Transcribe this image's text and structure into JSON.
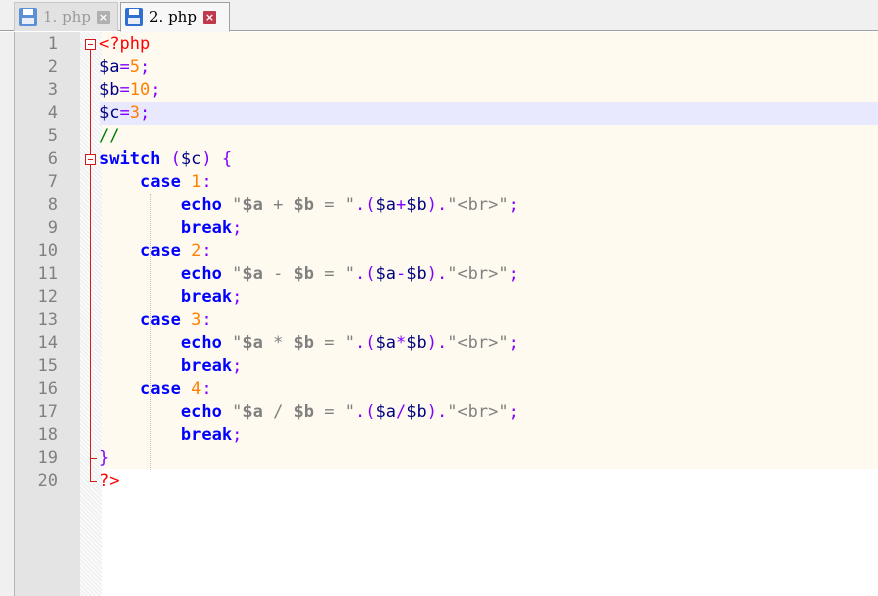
{
  "tabs": [
    {
      "label": "1. php",
      "active": false,
      "close_glyph": "×",
      "icon": "save-disk-icon",
      "icon_color": "#5b8fd6",
      "close_color": "#b0b0b0"
    },
    {
      "label": "2. php",
      "active": true,
      "close_glyph": "×",
      "icon": "save-disk-icon",
      "icon_color": "#2f6fd0",
      "close_color": "#c0384b"
    }
  ],
  "editor": {
    "current_line": 4,
    "line_numbers": [
      "1",
      "2",
      "3",
      "4",
      "5",
      "6",
      "7",
      "8",
      "9",
      "10",
      "11",
      "12",
      "13",
      "14",
      "15",
      "16",
      "17",
      "18",
      "19",
      "20"
    ],
    "lines": [
      [
        {
          "t": "<?php",
          "c": "php"
        }
      ],
      [
        {
          "t": "$a",
          "c": "var"
        },
        {
          "t": "=",
          "c": "op"
        },
        {
          "t": "5",
          "c": "num"
        },
        {
          "t": ";",
          "c": "op"
        }
      ],
      [
        {
          "t": "$b",
          "c": "var"
        },
        {
          "t": "=",
          "c": "op"
        },
        {
          "t": "10",
          "c": "num"
        },
        {
          "t": ";",
          "c": "op"
        }
      ],
      [
        {
          "t": "$c",
          "c": "var"
        },
        {
          "t": "=",
          "c": "op"
        },
        {
          "t": "3",
          "c": "num"
        },
        {
          "t": ";",
          "c": "op"
        }
      ],
      [
        {
          "t": "//",
          "c": "cm"
        }
      ],
      [
        {
          "t": "switch",
          "c": "kw"
        },
        {
          "t": " ",
          "c": ""
        },
        {
          "t": "(",
          "c": "op"
        },
        {
          "t": "$c",
          "c": "var"
        },
        {
          "t": ")",
          "c": "op"
        },
        {
          "t": " ",
          "c": ""
        },
        {
          "t": "{",
          "c": "op"
        }
      ],
      [
        {
          "t": "    ",
          "c": ""
        },
        {
          "t": "case",
          "c": "kw"
        },
        {
          "t": " ",
          "c": ""
        },
        {
          "t": "1",
          "c": "num"
        },
        {
          "t": ":",
          "c": "op"
        }
      ],
      [
        {
          "t": "        ",
          "c": ""
        },
        {
          "t": "echo",
          "c": "kw"
        },
        {
          "t": " ",
          "c": ""
        },
        {
          "t": "\"",
          "c": "str"
        },
        {
          "t": "$a",
          "c": "sv"
        },
        {
          "t": " + ",
          "c": "str"
        },
        {
          "t": "$b",
          "c": "sv"
        },
        {
          "t": " = \"",
          "c": "str"
        },
        {
          "t": ".",
          "c": "op"
        },
        {
          "t": "(",
          "c": "op"
        },
        {
          "t": "$a",
          "c": "var"
        },
        {
          "t": "+",
          "c": "op"
        },
        {
          "t": "$b",
          "c": "var"
        },
        {
          "t": ")",
          "c": "op"
        },
        {
          "t": ".",
          "c": "op"
        },
        {
          "t": "\"<br>\"",
          "c": "str"
        },
        {
          "t": ";",
          "c": "op"
        }
      ],
      [
        {
          "t": "        ",
          "c": ""
        },
        {
          "t": "break",
          "c": "kw"
        },
        {
          "t": ";",
          "c": "op"
        }
      ],
      [
        {
          "t": "    ",
          "c": ""
        },
        {
          "t": "case",
          "c": "kw"
        },
        {
          "t": " ",
          "c": ""
        },
        {
          "t": "2",
          "c": "num"
        },
        {
          "t": ":",
          "c": "op"
        }
      ],
      [
        {
          "t": "        ",
          "c": ""
        },
        {
          "t": "echo",
          "c": "kw"
        },
        {
          "t": " ",
          "c": ""
        },
        {
          "t": "\"",
          "c": "str"
        },
        {
          "t": "$a",
          "c": "sv"
        },
        {
          "t": " - ",
          "c": "str"
        },
        {
          "t": "$b",
          "c": "sv"
        },
        {
          "t": " = \"",
          "c": "str"
        },
        {
          "t": ".",
          "c": "op"
        },
        {
          "t": "(",
          "c": "op"
        },
        {
          "t": "$a",
          "c": "var"
        },
        {
          "t": "-",
          "c": "op"
        },
        {
          "t": "$b",
          "c": "var"
        },
        {
          "t": ")",
          "c": "op"
        },
        {
          "t": ".",
          "c": "op"
        },
        {
          "t": "\"<br>\"",
          "c": "str"
        },
        {
          "t": ";",
          "c": "op"
        }
      ],
      [
        {
          "t": "        ",
          "c": ""
        },
        {
          "t": "break",
          "c": "kw"
        },
        {
          "t": ";",
          "c": "op"
        }
      ],
      [
        {
          "t": "    ",
          "c": ""
        },
        {
          "t": "case",
          "c": "kw"
        },
        {
          "t": " ",
          "c": ""
        },
        {
          "t": "3",
          "c": "num"
        },
        {
          "t": ":",
          "c": "op"
        }
      ],
      [
        {
          "t": "        ",
          "c": ""
        },
        {
          "t": "echo",
          "c": "kw"
        },
        {
          "t": " ",
          "c": ""
        },
        {
          "t": "\"",
          "c": "str"
        },
        {
          "t": "$a",
          "c": "sv"
        },
        {
          "t": " * ",
          "c": "str"
        },
        {
          "t": "$b",
          "c": "sv"
        },
        {
          "t": " = \"",
          "c": "str"
        },
        {
          "t": ".",
          "c": "op"
        },
        {
          "t": "(",
          "c": "op"
        },
        {
          "t": "$a",
          "c": "var"
        },
        {
          "t": "*",
          "c": "op"
        },
        {
          "t": "$b",
          "c": "var"
        },
        {
          "t": ")",
          "c": "op"
        },
        {
          "t": ".",
          "c": "op"
        },
        {
          "t": "\"<br>\"",
          "c": "str"
        },
        {
          "t": ";",
          "c": "op"
        }
      ],
      [
        {
          "t": "        ",
          "c": ""
        },
        {
          "t": "break",
          "c": "kw"
        },
        {
          "t": ";",
          "c": "op"
        }
      ],
      [
        {
          "t": "    ",
          "c": ""
        },
        {
          "t": "case",
          "c": "kw"
        },
        {
          "t": " ",
          "c": ""
        },
        {
          "t": "4",
          "c": "num"
        },
        {
          "t": ":",
          "c": "op"
        }
      ],
      [
        {
          "t": "        ",
          "c": ""
        },
        {
          "t": "echo",
          "c": "kw"
        },
        {
          "t": " ",
          "c": ""
        },
        {
          "t": "\"",
          "c": "str"
        },
        {
          "t": "$a",
          "c": "sv"
        },
        {
          "t": " / ",
          "c": "str"
        },
        {
          "t": "$b",
          "c": "sv"
        },
        {
          "t": " = \"",
          "c": "str"
        },
        {
          "t": ".",
          "c": "op"
        },
        {
          "t": "(",
          "c": "op"
        },
        {
          "t": "$a",
          "c": "var"
        },
        {
          "t": "/",
          "c": "op"
        },
        {
          "t": "$b",
          "c": "var"
        },
        {
          "t": ")",
          "c": "op"
        },
        {
          "t": ".",
          "c": "op"
        },
        {
          "t": "\"<br>\"",
          "c": "str"
        },
        {
          "t": ";",
          "c": "op"
        }
      ],
      [
        {
          "t": "        ",
          "c": ""
        },
        {
          "t": "break",
          "c": "kw"
        },
        {
          "t": ";",
          "c": "op"
        }
      ],
      [
        {
          "t": "}",
          "c": "op"
        }
      ],
      [
        {
          "t": "?>",
          "c": "php"
        }
      ]
    ]
  },
  "colors": {
    "keyword": "#0000ff",
    "variable": "#000080",
    "number": "#ff8000",
    "operator": "#8000ff",
    "php_tag": "#ff0000",
    "comment": "#008000",
    "string": "#808080",
    "fold_marker": "#d21c1c",
    "current_line_bg": "#e8e8ff"
  }
}
